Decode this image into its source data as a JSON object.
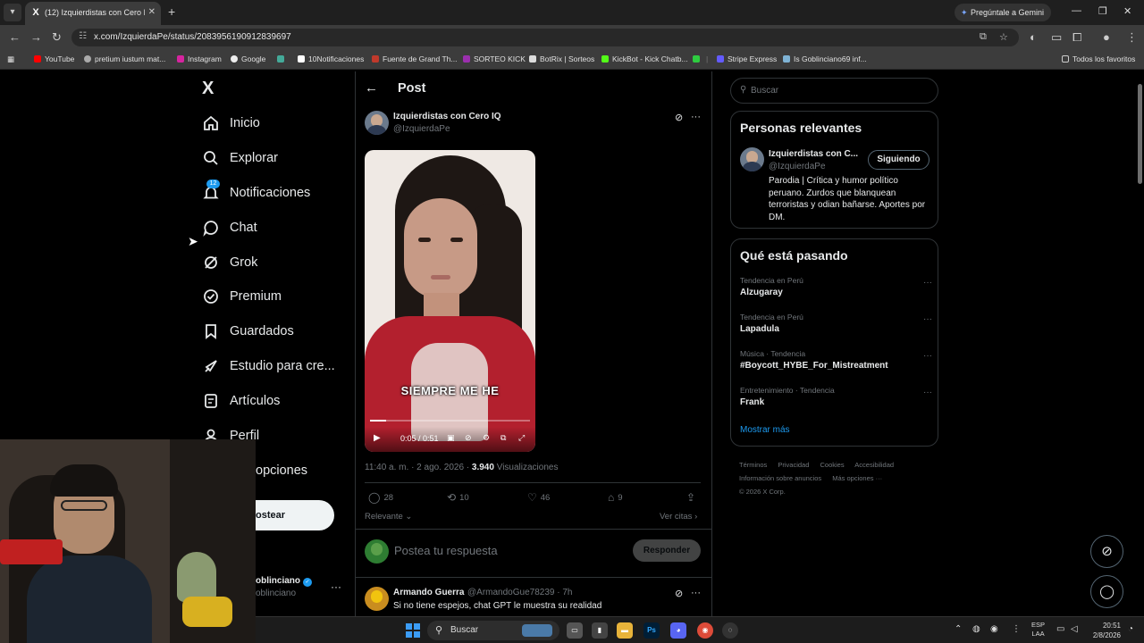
{
  "browser": {
    "tab_title": "(12) Izquierdistas con Cero IQ e",
    "new_tab": "+",
    "gemini": "Pregúntale a Gemini",
    "url": "x.com/IzquierdaPe/status/2083956190912839697",
    "bookmarks": [
      "YouTube",
      "pretium iustum mat...",
      "Instagram",
      "Google",
      "10Notificaciones",
      "Fuente de Grand Th...",
      "SORTEO KICK",
      "BotRix | Sorteos",
      "KickBot - Kick Chatb...",
      "Stripe Express",
      "Is Goblinciano69 inf..."
    ],
    "all_bookmarks": "Todos los favoritos"
  },
  "sidebar": {
    "logo": "X",
    "notif_count": "12",
    "items": [
      "Inicio",
      "Explorar",
      "Notificaciones",
      "Chat",
      "Grok",
      "Premium",
      "Guardados",
      "Estudio para cre...",
      "Artículos",
      "Perfil",
      "Más opciones"
    ],
    "more_options_visible": "opciones",
    "post_button": "ostear",
    "profile_name": "oblinciano",
    "profile_handle": "oblinciano"
  },
  "post": {
    "header": "Post",
    "author_name": "Izquierdistas con Cero IQ",
    "author_handle": "@IzquierdaPe",
    "video_caption": "SIEMPRE ME HE",
    "video_time": "0:05 / 0:51",
    "video_progress": 0.1,
    "timestamp": "11:40 a. m. · 2 ago. 2026 · ",
    "views_count": "3.940",
    "views_label": " Visualizaciones",
    "replies": "28",
    "reposts": "10",
    "likes": "46",
    "bookmarks": "9",
    "sort": "Relevante",
    "quotes": "Ver citas",
    "reply_placeholder": "Postea tu respuesta",
    "reply_button": "Responder"
  },
  "comment": {
    "name": "Armando Guerra",
    "handle": "@ArmandoGue78239 · 7h",
    "text": "Si no tiene espejos, chat GPT le muestra su realidad"
  },
  "right": {
    "search_placeholder": "Buscar",
    "relevant_title": "Personas relevantes",
    "relevant_name": "Izquierdistas con C...",
    "relevant_handle": "@IzquierdaPe",
    "follow_label": "Siguiendo",
    "relevant_bio": "Parodia | Crítica y humor político peruano. Zurdos que blanquean terroristas y odian bañarse. Aportes por DM.",
    "trending_title": "Qué está pasando",
    "trends": [
      {
        "context": "Tendencia en Perú",
        "name": "Alzugaray"
      },
      {
        "context": "Tendencia en Perú",
        "name": "Lapadula"
      },
      {
        "context": "Música · Tendencia",
        "name": "#Boycott_HYBE_For_Mistreatment"
      },
      {
        "context": "Entretenimiento · Tendencia",
        "name": "Frank"
      }
    ],
    "show_more": "Mostrar más",
    "footer": [
      "Términos",
      "Privacidad",
      "Cookies",
      "Accesibilidad",
      "Información sobre anuncios",
      "Más opciones ···",
      "© 2026 X Corp."
    ]
  },
  "taskbar": {
    "search": "Buscar",
    "lang1": "ESP",
    "lang2": "LAA",
    "time": "20:51",
    "date": "2/8/2026"
  },
  "colors": {
    "accent": "#1d9bf0",
    "background": "#000000",
    "border": "#2f3336",
    "muted_text": "#71767b"
  }
}
